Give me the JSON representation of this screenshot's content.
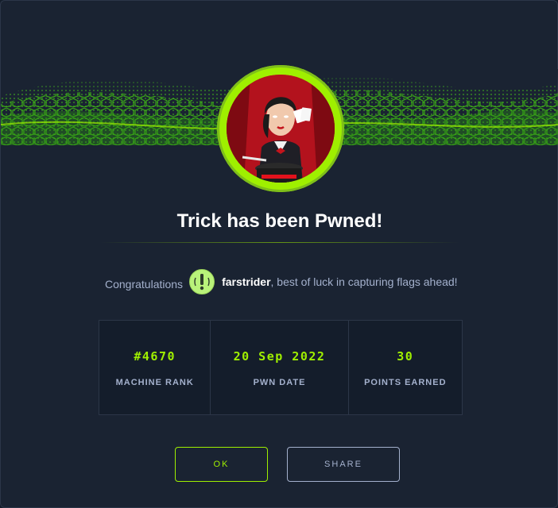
{
  "title": "Trick has been Pwned!",
  "congrats": {
    "lead": "Congratulations",
    "username": "farstrider",
    "message": ", best of luck in capturing flags ahead!"
  },
  "stats": [
    {
      "value": "#4670",
      "label": "MACHINE RANK"
    },
    {
      "value": "20 Sep 2022",
      "label": "PWN DATE"
    },
    {
      "value": "30",
      "label": "POINTS EARNED"
    }
  ],
  "buttons": {
    "ok": "OK",
    "share": "SHARE"
  },
  "colors": {
    "accent": "#9fef00",
    "background": "#1a2332",
    "muted_text": "#a4b1cd"
  },
  "icons": {
    "machine_avatar": "magician-avatar-icon",
    "banner": "green-cube-wave-banner",
    "user_avatar": "user-avatar-icon"
  }
}
